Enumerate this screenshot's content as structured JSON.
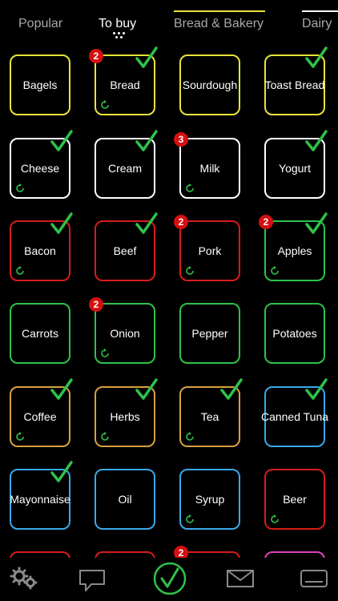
{
  "colors": {
    "bread_bakery": "#e8e33a",
    "dairy": "#ffffff",
    "meat_produce": "#d81b1b",
    "vegetables": "#2ec24a",
    "pantry": "#d8a040",
    "condiments": "#3aa8e8",
    "check": "#2ec24a",
    "badge": "#d51010"
  },
  "tabs": [
    {
      "label": "Popular"
    },
    {
      "label": "To buy"
    },
    {
      "label": "Bread & Bakery"
    },
    {
      "label": "Dairy"
    }
  ],
  "tiles": [
    {
      "label": "Bagels",
      "color": "#e8e33a",
      "checked": false,
      "badge": "",
      "cycle": false
    },
    {
      "label": "Bread",
      "color": "#e8e33a",
      "checked": true,
      "badge": "2",
      "cycle": true
    },
    {
      "label": "Sourdough",
      "color": "#e8e33a",
      "checked": false,
      "badge": "",
      "cycle": false
    },
    {
      "label": "Toast Bread",
      "color": "#e8e33a",
      "checked": true,
      "badge": "",
      "cycle": false
    },
    {
      "label": "Cheese",
      "color": "#ffffff",
      "checked": true,
      "badge": "",
      "cycle": true
    },
    {
      "label": "Cream",
      "color": "#ffffff",
      "checked": true,
      "badge": "",
      "cycle": false
    },
    {
      "label": "Milk",
      "color": "#ffffff",
      "checked": false,
      "badge": "3",
      "cycle": true
    },
    {
      "label": "Yogurt",
      "color": "#ffffff",
      "checked": true,
      "badge": "",
      "cycle": false
    },
    {
      "label": "Bacon",
      "color": "#d81b1b",
      "checked": true,
      "badge": "",
      "cycle": true
    },
    {
      "label": "Beef",
      "color": "#d81b1b",
      "checked": true,
      "badge": "",
      "cycle": false
    },
    {
      "label": "Pork",
      "color": "#d81b1b",
      "checked": false,
      "badge": "2",
      "cycle": true
    },
    {
      "label": "Apples",
      "color": "#2ec24a",
      "checked": true,
      "badge": "2",
      "cycle": true
    },
    {
      "label": "Carrots",
      "color": "#2ec24a",
      "checked": false,
      "badge": "",
      "cycle": false
    },
    {
      "label": "Onion",
      "color": "#2ec24a",
      "checked": false,
      "badge": "2",
      "cycle": true
    },
    {
      "label": "Pepper",
      "color": "#2ec24a",
      "checked": false,
      "badge": "",
      "cycle": false
    },
    {
      "label": "Potatoes",
      "color": "#2ec24a",
      "checked": false,
      "badge": "",
      "cycle": false
    },
    {
      "label": "Coffee",
      "color": "#d8a040",
      "checked": true,
      "badge": "",
      "cycle": true
    },
    {
      "label": "Herbs",
      "color": "#d8a040",
      "checked": true,
      "badge": "",
      "cycle": true
    },
    {
      "label": "Tea",
      "color": "#d8a040",
      "checked": true,
      "badge": "",
      "cycle": true
    },
    {
      "label": "Canned Tuna",
      "color": "#3aa8e8",
      "checked": true,
      "badge": "",
      "cycle": false
    },
    {
      "label": "Mayonnaise",
      "color": "#3aa8e8",
      "checked": true,
      "badge": "",
      "cycle": false
    },
    {
      "label": "Oil",
      "color": "#3aa8e8",
      "checked": false,
      "badge": "",
      "cycle": false
    },
    {
      "label": "Syrup",
      "color": "#3aa8e8",
      "checked": false,
      "badge": "",
      "cycle": true
    },
    {
      "label": "Beer",
      "color": "#d81b1b",
      "checked": false,
      "badge": "",
      "cycle": true
    },
    {
      "label": "",
      "color": "#d81b1b",
      "checked": false,
      "badge": "",
      "cycle": false
    },
    {
      "label": "",
      "color": "#d81b1b",
      "checked": false,
      "badge": "",
      "cycle": false
    },
    {
      "label": "",
      "color": "#d81b1b",
      "checked": false,
      "badge": "2",
      "cycle": false
    },
    {
      "label": "",
      "color": "#e040c0",
      "checked": false,
      "badge": "",
      "cycle": false
    }
  ],
  "bottombar": {
    "icons": [
      "gears-icon",
      "speech-bubble-icon",
      "checkmark-circle-icon",
      "envelope-icon",
      "tablet-icon"
    ]
  }
}
